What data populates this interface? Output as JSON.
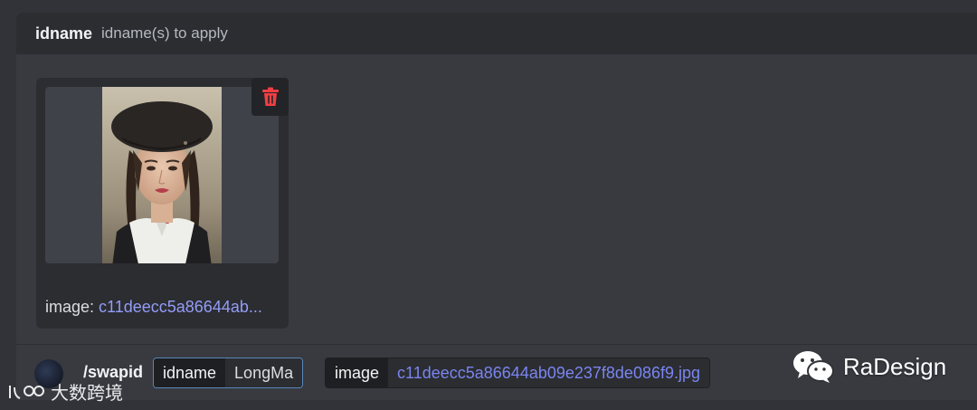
{
  "option_header": {
    "name": "idname",
    "description": "idname(s) to apply"
  },
  "attachment": {
    "caption_label": "image:",
    "caption_filename": "c11deecc5a86644ab..."
  },
  "command_bar": {
    "command": "/swapid",
    "options": [
      {
        "key": "idname",
        "value": "LongMa"
      },
      {
        "key": "image",
        "value": "c11deecc5a86644ab09e237f8de086f9.jpg"
      }
    ]
  },
  "watermarks": {
    "wechat_text": "RaDesign",
    "left_text": "大数跨境"
  },
  "colors": {
    "background": "#313338",
    "panel": "#383a40",
    "header": "#2b2d31",
    "delete_red": "#f23f43",
    "link_blue": "#949cf7",
    "active_chip_border": "#5a86b8"
  },
  "icons": {
    "delete": "trash-icon",
    "wechat": "wechat-icon"
  }
}
